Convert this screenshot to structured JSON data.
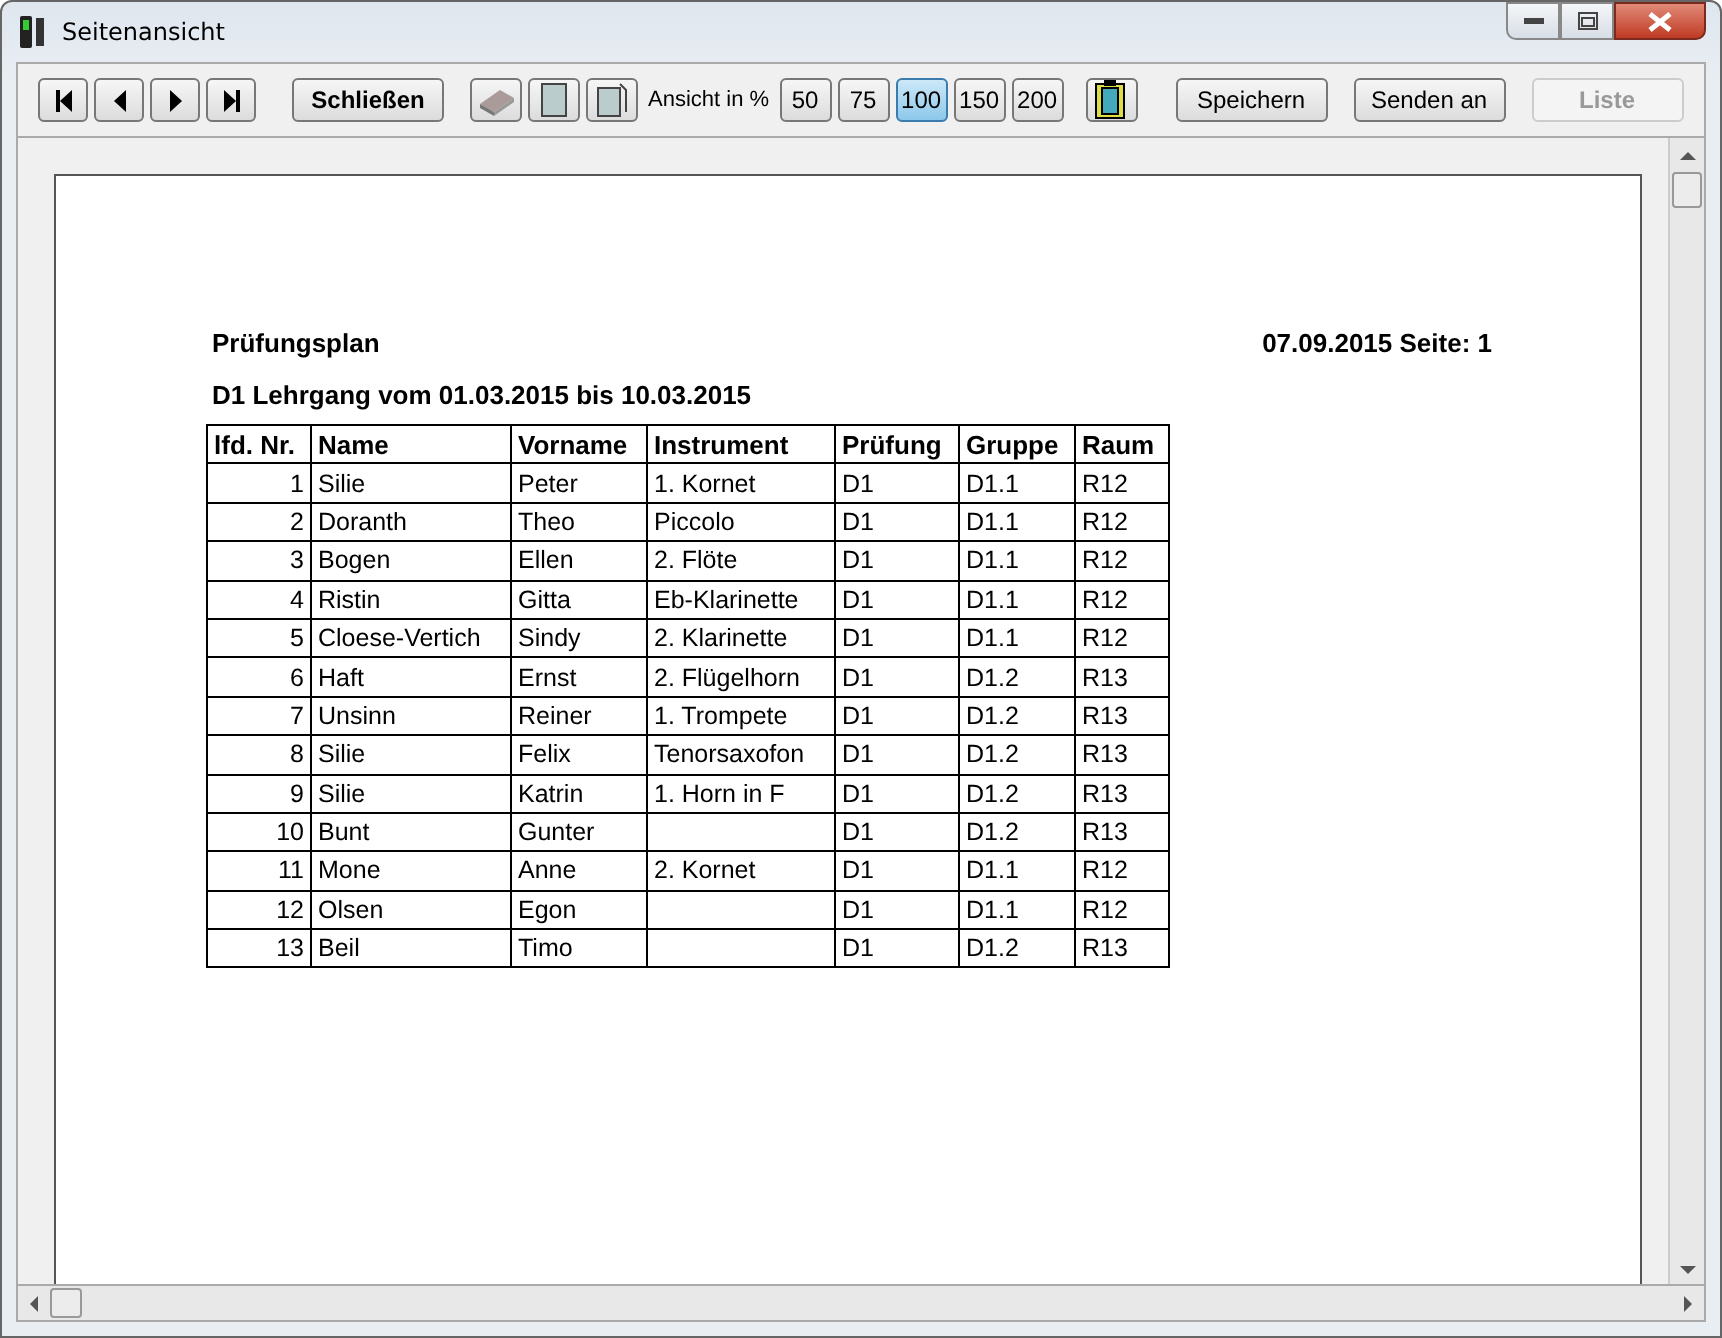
{
  "window": {
    "title": "Seitenansicht"
  },
  "toolbar": {
    "close_button": "Schließen",
    "zoom_label": "Ansicht in %",
    "zoom_levels": [
      {
        "label": "50",
        "selected": false
      },
      {
        "label": "75",
        "selected": false
      },
      {
        "label": "100",
        "selected": true
      },
      {
        "label": "150",
        "selected": false
      },
      {
        "label": "200",
        "selected": false
      }
    ],
    "buttons": [
      {
        "label": "Speichern",
        "disabled": false
      },
      {
        "label": "Senden an",
        "disabled": false
      },
      {
        "label": "Liste",
        "disabled": true
      }
    ]
  },
  "report": {
    "title": "Prüfungsplan",
    "date_page": "07.09.2015 Seite: 1",
    "subtitle": "D1 Lehrgang vom 01.03.2015 bis 10.03.2015",
    "columns": [
      "lfd. Nr.",
      "Name",
      "Vorname",
      "Instrument",
      "Prüfung",
      "Gruppe",
      "Raum"
    ],
    "rows": [
      [
        "1",
        "Silie",
        "Peter",
        "1. Kornet",
        "D1",
        "D1.1",
        "R12"
      ],
      [
        "2",
        "Doranth",
        "Theo",
        "Piccolo",
        "D1",
        "D1.1",
        "R12"
      ],
      [
        "3",
        "Bogen",
        "Ellen",
        "2. Flöte",
        "D1",
        "D1.1",
        "R12"
      ],
      [
        "4",
        "Ristin",
        "Gitta",
        "Eb-Klarinette",
        "D1",
        "D1.1",
        "R12"
      ],
      [
        "5",
        "Cloese-Vertich",
        "Sindy",
        "2. Klarinette",
        "D1",
        "D1.1",
        "R12"
      ],
      [
        "6",
        "Haft",
        "Ernst",
        "2. Flügelhorn",
        "D1",
        "D1.2",
        "R13"
      ],
      [
        "7",
        "Unsinn",
        "Reiner",
        "1. Trompete",
        "D1",
        "D1.2",
        "R13"
      ],
      [
        "8",
        "Silie",
        "Felix",
        "Tenorsaxofon",
        "D1",
        "D1.2",
        "R13"
      ],
      [
        "9",
        "Silie",
        "Katrin",
        "1. Horn in F",
        "D1",
        "D1.2",
        "R13"
      ],
      [
        "10",
        "Bunt",
        "Gunter",
        "",
        "D1",
        "D1.2",
        "R13"
      ],
      [
        "11",
        "Mone",
        "Anne",
        "2. Kornet",
        "D1",
        "D1.1",
        "R12"
      ],
      [
        "12",
        "Olsen",
        "Egon",
        "",
        "D1",
        "D1.1",
        "R12"
      ],
      [
        "13",
        "Beil",
        "Timo",
        "",
        "D1",
        "D1.2",
        "R13"
      ]
    ]
  }
}
